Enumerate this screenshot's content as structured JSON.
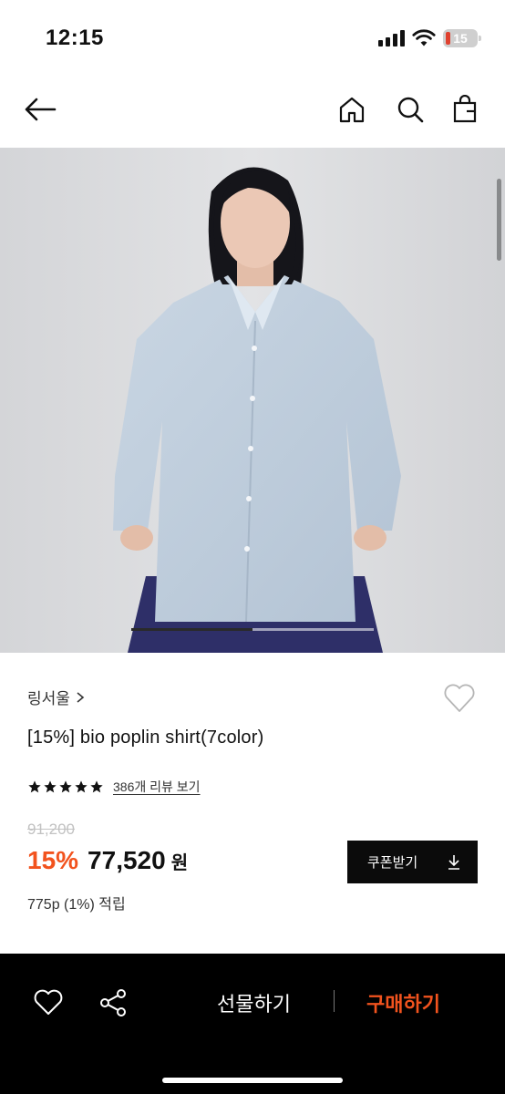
{
  "status_bar": {
    "time": "12:15",
    "battery_level": "15",
    "icons": [
      "signal-icon",
      "wifi-icon",
      "battery-icon"
    ]
  },
  "nav": {
    "icons": [
      "back-arrow-icon",
      "home-icon",
      "search-icon",
      "shopping-bag-icon"
    ]
  },
  "hero": {
    "image": "model-wearing-light-blue-shirt",
    "slide_progress": 0.5
  },
  "product": {
    "brand": "링서울",
    "brand_chevron": "chevron-right-icon",
    "title": "[15%] bio poplin shirt(7color)",
    "rating_stars": 5,
    "review_link": "386개 리뷰 보기",
    "original_price": "91,200",
    "discount": "15%",
    "price": "77,520",
    "currency": "원",
    "points": "775p (1%) 적립",
    "coupon_button": "쿠폰받기"
  },
  "bottom_bar": {
    "gift_label": "선물하기",
    "buy_label": "구매하기",
    "icons": [
      "heart-icon",
      "share-icon"
    ]
  },
  "colors": {
    "accent": "#f2531e",
    "dark": "#0b0b0b",
    "muted": "#c2c2c2"
  }
}
